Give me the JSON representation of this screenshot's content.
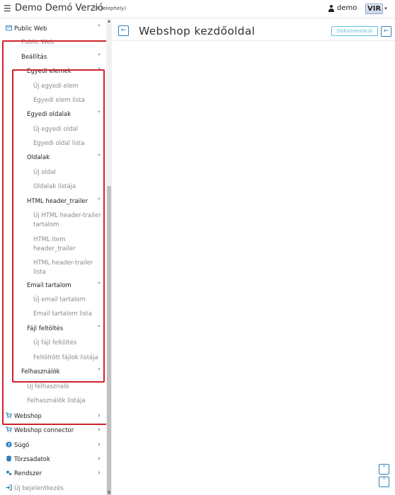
{
  "topbar": {
    "menu_icon": "hamburger-icon",
    "title": "Demo Demó Verzió",
    "subtitle": "(A telephely)",
    "user_name": "demo",
    "logo_text": "VIR"
  },
  "sidebar": {
    "items": [
      {
        "label": "Public Web",
        "icon": "globe-icon",
        "chevron": "˅"
      },
      {
        "label": "Public Web"
      },
      {
        "label": "Beállítás",
        "chevron": "˅"
      },
      {
        "label": "Egyedi elemek",
        "chevron": "˅"
      },
      {
        "label": "Új egyedi elem"
      },
      {
        "label": "Egyedi elem lista"
      },
      {
        "label": "Egyedi oldalak",
        "chevron": "˅"
      },
      {
        "label": "Új egyedi oldal"
      },
      {
        "label": "Egyedi oldal lista"
      },
      {
        "label": "Oldalak",
        "chevron": "˅"
      },
      {
        "label": "Új oldal"
      },
      {
        "label": "Oldalak listája"
      },
      {
        "label": "HTML header_trailer",
        "chevron": "˅"
      },
      {
        "label_line1": "Új HTML header-trailer",
        "label_line2": "tartalom"
      },
      {
        "label_line1": "HTML item",
        "label_line2": "header_trailer"
      },
      {
        "label_line1": "HTML header-trailer",
        "label_line2": "lista"
      },
      {
        "label": "Email tartalom",
        "chevron": "˅"
      },
      {
        "label": "Új email tartalom"
      },
      {
        "label": "Email tartalom lista"
      },
      {
        "label": "Fájl feltöltés",
        "chevron": "˅"
      },
      {
        "label": "Új fájl feltöltés"
      },
      {
        "label": "Feltöltött fájlok listája"
      },
      {
        "label": "Felhasználók",
        "chevron": "˅"
      },
      {
        "label": "Új felhasználó"
      },
      {
        "label": "Felhasználók listája"
      },
      {
        "label": "Webshop",
        "icon": "cart-icon",
        "chevron": "›"
      },
      {
        "label": "Webshop connector",
        "icon": "cart-icon",
        "chevron": "›"
      },
      {
        "label": "Súgó",
        "icon": "help-icon",
        "chevron": "›"
      },
      {
        "label": "Törzsadatok",
        "icon": "database-icon",
        "chevron": "›"
      },
      {
        "label": "Rendszer",
        "icon": "cogs-icon",
        "chevron": "›"
      },
      {
        "label": "Új bejelentkezés",
        "icon": "login-icon"
      }
    ]
  },
  "main": {
    "back_glyph": "←",
    "title": "Webshop kezdőoldal",
    "doc_button": "Dokumentáció",
    "collapse_glyph": "←",
    "scroll_up_glyph": "˄",
    "scroll_down_glyph": "˅"
  },
  "colors": {
    "highlight_border": "#d0212a",
    "primary": "#2f7fb8",
    "info": "#5bc0de"
  }
}
